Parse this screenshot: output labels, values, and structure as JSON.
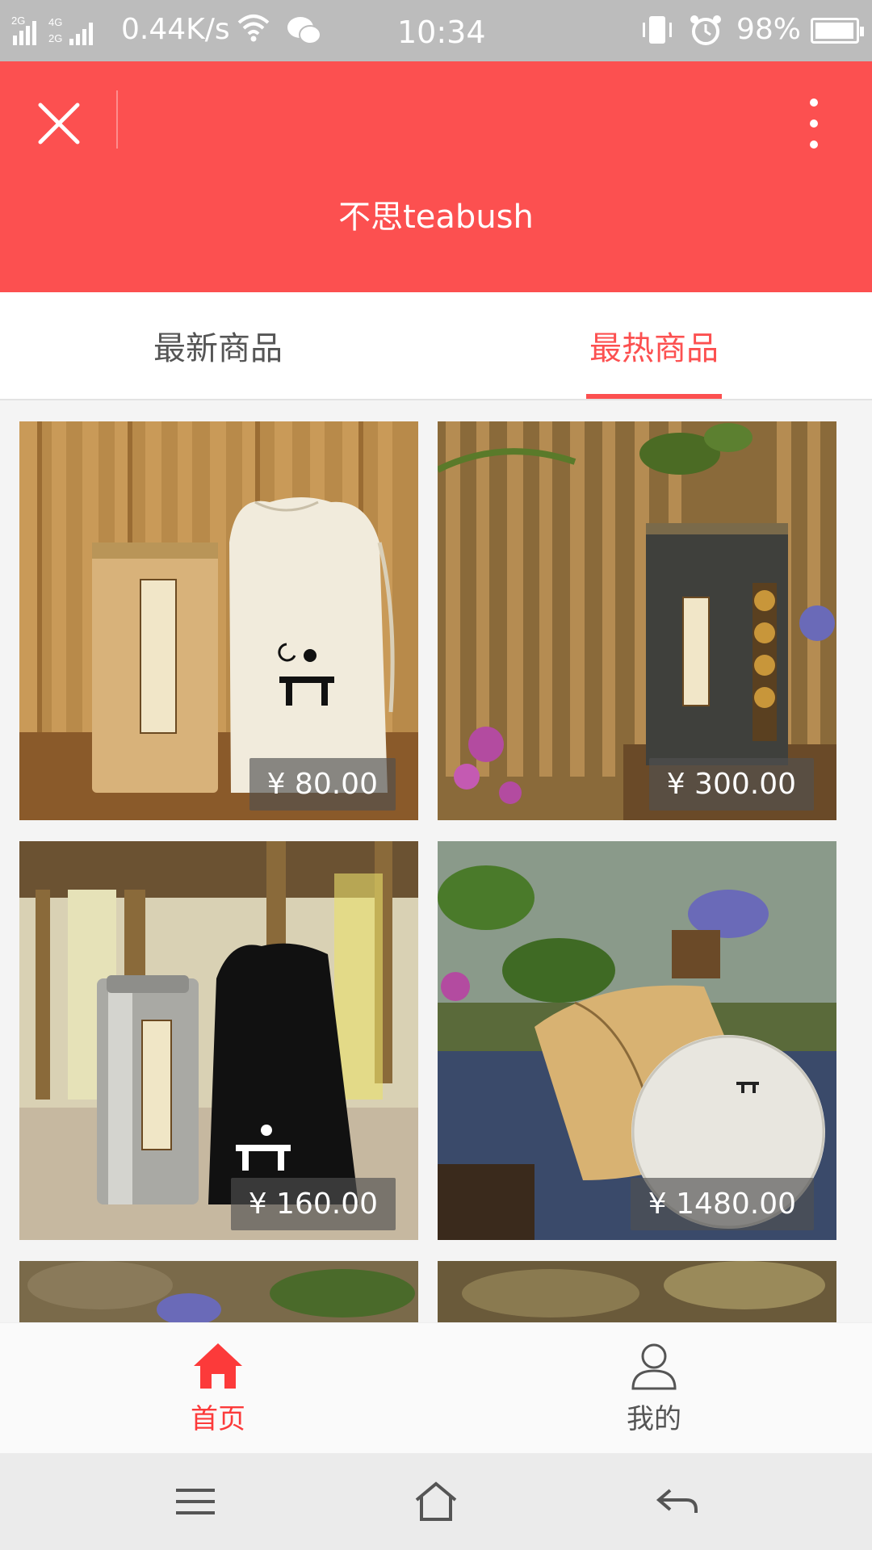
{
  "status_bar": {
    "network_label": "0.44K/s",
    "time": "10:34",
    "battery_text": "98%",
    "battery_level": 0.98
  },
  "header": {
    "title": "不思teabush",
    "close_icon": "close-icon",
    "more_icon": "more-vertical-icon"
  },
  "tabs": [
    {
      "label": "最新商品",
      "active": false
    },
    {
      "label": "最热商品",
      "active": true
    }
  ],
  "products": [
    {
      "price": "¥ 80.00"
    },
    {
      "price": "¥ 300.00"
    },
    {
      "price": "¥ 160.00"
    },
    {
      "price": "¥ 1480.00"
    }
  ],
  "bottom_nav": [
    {
      "label": "首页",
      "icon": "home-icon",
      "active": true
    },
    {
      "label": "我的",
      "icon": "user-icon",
      "active": false
    }
  ],
  "colors": {
    "accent": "#fc5050",
    "status_bar": "#bcbcbc",
    "tab_inactive": "#555555"
  }
}
